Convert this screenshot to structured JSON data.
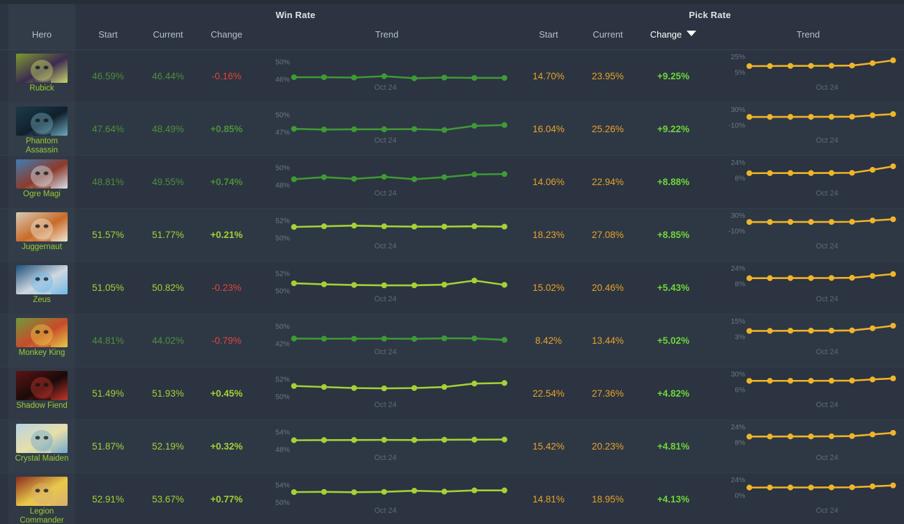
{
  "header": {
    "groups": [
      {
        "label": "Win Rate"
      },
      {
        "label": "Pick Rate"
      }
    ],
    "columns": {
      "hero": "Hero",
      "win_start": "Start",
      "win_current": "Current",
      "win_change": "Change",
      "win_trend": "Trend",
      "pick_start": "Start",
      "pick_current": "Current",
      "pick_change": "Change",
      "pick_trend": "Trend"
    },
    "sorted_column": "pick_change",
    "sort_direction": "desc",
    "sort_icon": "chevron-down-icon"
  },
  "colors": {
    "page_bg": "#2b3440",
    "row_alt_bg": "#2e3845",
    "hero_col_bg": "#323c48",
    "win_line": "#5aa832",
    "win_line_bright": "#a5d136",
    "pick_line": "#f0b429",
    "positive": "#6fd63a",
    "negative": "#e2453c",
    "pick_value": "#e8a22a",
    "hero_name": "#9acd32",
    "axis_label": "#6d7884"
  },
  "chart_data": {
    "type": "line",
    "title": "Dota 2 Hero Win Rate and Pick Rate Trends",
    "xlabel": "Oct 24",
    "x_tick_labels": [
      "Oct 24"
    ],
    "grid": false,
    "legend": "none",
    "series_count_per_row": 2,
    "rows": [
      {
        "hero": "Rubick",
        "portrait_colors": [
          "#7d9b2e",
          "#3c2a52",
          "#c8d66a"
        ],
        "win": {
          "start": "46.59%",
          "current": "46.44%",
          "change": "-0.16%",
          "change_sign": "neg",
          "ylim_labels": [
            "50%",
            "46%"
          ],
          "ylim": [
            46,
            50
          ],
          "values": [
            46.5,
            46.5,
            46.4,
            46.8,
            46.2,
            46.4,
            46.3,
            46.3
          ],
          "line_color": "#3f9a35"
        },
        "pick": {
          "start": "14.70%",
          "current": "23.95%",
          "change": "+9.25%",
          "ylim_labels": [
            "25%",
            "5%"
          ],
          "ylim": [
            5,
            25
          ],
          "values": [
            14.7,
            14.8,
            15.0,
            15.1,
            15.2,
            15.6,
            19.5,
            23.95
          ]
        }
      },
      {
        "hero": "Phantom Assassin",
        "portrait_colors": [
          "#1e3a4a",
          "#10202c",
          "#6fa9bd"
        ],
        "win": {
          "start": "47.64%",
          "current": "48.49%",
          "change": "+0.85%",
          "change_sign": "pos",
          "ylim_labels": [
            "50%",
            "47%"
          ],
          "ylim": [
            47,
            50
          ],
          "values": [
            47.65,
            47.5,
            47.55,
            47.55,
            47.6,
            47.4,
            48.3,
            48.49
          ],
          "line_color": "#3f9a35"
        },
        "pick": {
          "start": "16.04%",
          "current": "25.26%",
          "change": "+9.22%",
          "ylim_labels": [
            "30%",
            "-10%"
          ],
          "ylim": [
            -10,
            30
          ],
          "values": [
            16.0,
            16.1,
            16.3,
            16.3,
            16.4,
            16.6,
            21.0,
            25.26
          ]
        }
      },
      {
        "hero": "Ogre Magi",
        "portrait_colors": [
          "#3f7db5",
          "#8c3b2a",
          "#d8e0e8"
        ],
        "win": {
          "start": "48.81%",
          "current": "49.55%",
          "change": "+0.74%",
          "change_sign": "pos",
          "ylim_labels": [
            "50%",
            "48%"
          ],
          "ylim": [
            48,
            50
          ],
          "values": [
            48.8,
            49.1,
            48.85,
            49.15,
            48.8,
            49.1,
            49.5,
            49.55
          ],
          "line_color": "#3f9a35"
        },
        "pick": {
          "start": "14.06%",
          "current": "22.94%",
          "change": "+8.88%",
          "ylim_labels": [
            "24%",
            "8%"
          ],
          "ylim": [
            8,
            24
          ],
          "values": [
            14.05,
            14.1,
            14.2,
            14.2,
            14.3,
            14.5,
            18.4,
            22.94
          ]
        }
      },
      {
        "hero": "Juggernaut",
        "portrait_colors": [
          "#d5cbb6",
          "#c96a28",
          "#f0e6d2"
        ],
        "win": {
          "start": "51.57%",
          "current": "51.77%",
          "change": "+0.21%",
          "change_sign": "pos",
          "ylim_labels": [
            "52%",
            "50%"
          ],
          "ylim": [
            50,
            52
          ],
          "values": [
            51.55,
            51.65,
            51.75,
            51.65,
            51.6,
            51.6,
            51.65,
            51.6
          ],
          "line_color": "#a5d136"
        },
        "pick": {
          "start": "18.23%",
          "current": "27.08%",
          "change": "+8.85%",
          "ylim_labels": [
            "30%",
            "-10%"
          ],
          "ylim": [
            -10,
            30
          ],
          "values": [
            18.2,
            18.3,
            18.4,
            18.4,
            18.5,
            18.8,
            23.0,
            27.08
          ]
        }
      },
      {
        "hero": "Zeus",
        "portrait_colors": [
          "#1c4f7a",
          "#cfd8e0",
          "#6fb8e8"
        ],
        "win": {
          "start": "51.05%",
          "current": "50.82%",
          "change": "-0.23%",
          "change_sign": "neg",
          "ylim_labels": [
            "52%",
            "50%"
          ],
          "ylim": [
            50,
            52
          ],
          "values": [
            51.05,
            50.9,
            50.8,
            50.75,
            50.75,
            50.85,
            51.45,
            50.82
          ],
          "line_color": "#a5d136"
        },
        "pick": {
          "start": "15.02%",
          "current": "20.46%",
          "change": "+5.43%",
          "ylim_labels": [
            "24%",
            "8%"
          ],
          "ylim": [
            8,
            24
          ],
          "values": [
            15.0,
            15.1,
            15.2,
            15.2,
            15.3,
            15.6,
            17.9,
            20.46
          ]
        }
      },
      {
        "hero": "Monkey King",
        "portrait_colors": [
          "#6f9b3a",
          "#c94a2a",
          "#e8c94a"
        ],
        "win": {
          "start": "44.81%",
          "current": "44.02%",
          "change": "-0.79%",
          "change_sign": "neg",
          "ylim_labels": [
            "50%",
            "42%"
          ],
          "ylim": [
            42,
            50
          ],
          "values": [
            44.8,
            44.7,
            44.7,
            44.75,
            44.65,
            44.95,
            44.9,
            44.02
          ],
          "line_color": "#3f9a35"
        },
        "pick": {
          "start": "8.42%",
          "current": "13.44%",
          "change": "+5.02%",
          "ylim_labels": [
            "15%",
            "3%"
          ],
          "ylim": [
            3,
            15
          ],
          "values": [
            8.4,
            8.5,
            8.6,
            8.65,
            8.7,
            8.9,
            11.0,
            13.44
          ]
        }
      },
      {
        "hero": "Shadow Fiend",
        "portrait_colors": [
          "#5c1414",
          "#1a0a0a",
          "#c4352a"
        ],
        "win": {
          "start": "51.49%",
          "current": "51.93%",
          "change": "+0.45%",
          "change_sign": "pos",
          "ylim_labels": [
            "52%",
            "50%"
          ],
          "ylim": [
            50,
            52
          ],
          "values": [
            51.5,
            51.35,
            51.2,
            51.15,
            51.2,
            51.35,
            51.85,
            51.93
          ],
          "line_color": "#a5d136"
        },
        "pick": {
          "start": "22.54%",
          "current": "27.36%",
          "change": "+4.82%",
          "ylim_labels": [
            "30%",
            "6%"
          ],
          "ylim": [
            6,
            30
          ],
          "values": [
            22.5,
            22.6,
            22.7,
            22.7,
            22.8,
            23.1,
            25.3,
            27.36
          ]
        }
      },
      {
        "hero": "Crystal Maiden",
        "portrait_colors": [
          "#b9d3e4",
          "#e8dfa8",
          "#6fa8d0"
        ],
        "win": {
          "start": "51.87%",
          "current": "52.19%",
          "change": "+0.32%",
          "change_sign": "pos",
          "ylim_labels": [
            "54%",
            "48%"
          ],
          "ylim": [
            48,
            54
          ],
          "values": [
            51.9,
            51.95,
            52.0,
            52.05,
            52.0,
            52.1,
            52.15,
            52.19
          ],
          "line_color": "#a5d136"
        },
        "pick": {
          "start": "15.42%",
          "current": "20.23%",
          "change": "+4.81%",
          "ylim_labels": [
            "24%",
            "8%"
          ],
          "ylim": [
            8,
            24
          ],
          "values": [
            15.4,
            15.5,
            15.6,
            15.6,
            15.7,
            16.0,
            18.1,
            20.23
          ]
        }
      },
      {
        "hero": "Legion Commander",
        "portrait_colors": [
          "#8c2a1e",
          "#e8c94a",
          "#d8b070"
        ],
        "win": {
          "start": "52.91%",
          "current": "53.67%",
          "change": "+0.77%",
          "change_sign": "pos",
          "ylim_labels": [
            "54%",
            "50%"
          ],
          "ylim": [
            50,
            54
          ],
          "values": [
            52.9,
            52.95,
            52.85,
            52.95,
            53.3,
            53.05,
            53.4,
            53.4
          ],
          "line_color": "#a5d136"
        },
        "pick": {
          "start": "14.81%",
          "current": "18.95%",
          "change": "+4.13%",
          "ylim_labels": [
            "24%",
            "0%"
          ],
          "ylim": [
            0,
            24
          ],
          "values": [
            14.8,
            14.9,
            15.0,
            15.0,
            15.1,
            15.3,
            17.1,
            18.95
          ]
        }
      }
    ]
  }
}
